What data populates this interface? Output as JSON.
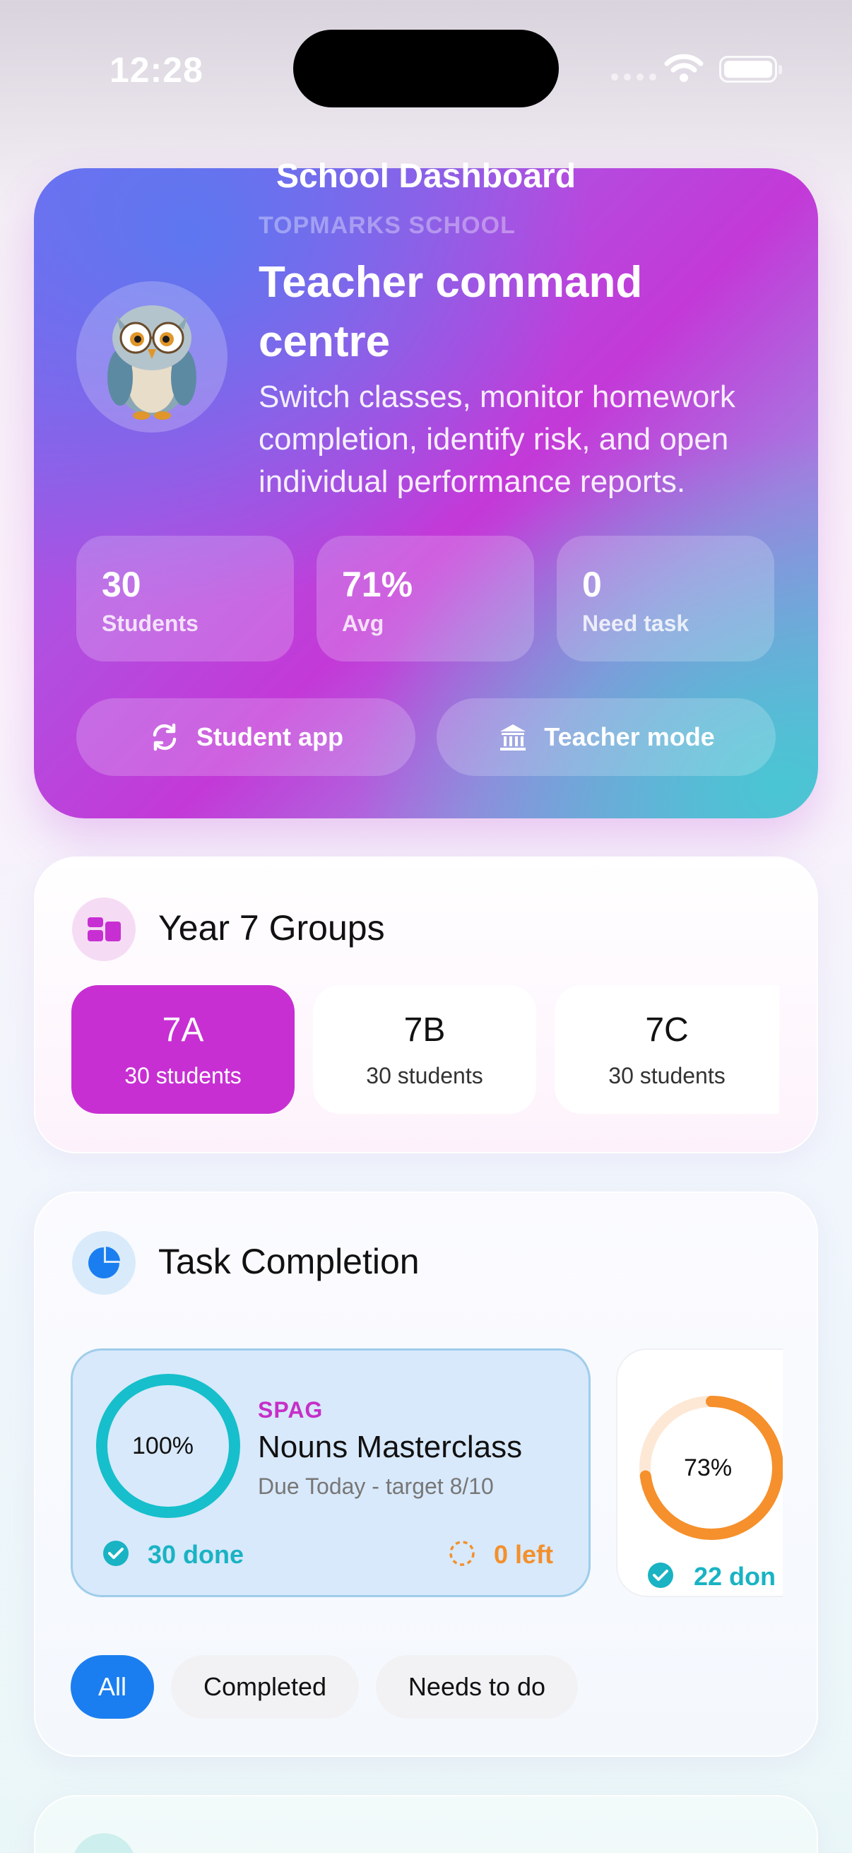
{
  "status_bar": {
    "time": "12:28"
  },
  "nav": {
    "title": "School Dashboard"
  },
  "hero": {
    "school": "TOPMARKS SCHOOL",
    "title": "Teacher command centre",
    "subtitle": "Switch classes, monitor homework completion, identify risk, and open individual performance reports.",
    "stats": [
      {
        "value": "30",
        "label": "Students"
      },
      {
        "value": "71%",
        "label": "Avg"
      },
      {
        "value": "0",
        "label": "Need task"
      }
    ],
    "buttons": {
      "student_app": "Student app",
      "teacher_mode": "Teacher mode"
    }
  },
  "groups": {
    "title": "Year 7 Groups",
    "items": [
      {
        "name": "7A",
        "count": "30 students",
        "active": true
      },
      {
        "name": "7B",
        "count": "30 students",
        "active": false
      },
      {
        "name": "7C",
        "count": "30 students",
        "active": false
      }
    ]
  },
  "tasks": {
    "title": "Task Completion",
    "cards": [
      {
        "percent": "100%",
        "progress": 1.0,
        "category": "SPAG",
        "name": "Nouns Masterclass",
        "due": "Due Today - target 8/10",
        "done": "30 done",
        "left": "0 left"
      },
      {
        "percent": "73%",
        "progress": 0.73,
        "done": "22 don"
      }
    ],
    "filters": [
      "All",
      "Completed",
      "Needs to do"
    ]
  },
  "colors": {
    "accent": "#c72fd3",
    "teal": "#19b3c3",
    "orange": "#f3902b",
    "blue": "#1a7ef0"
  }
}
